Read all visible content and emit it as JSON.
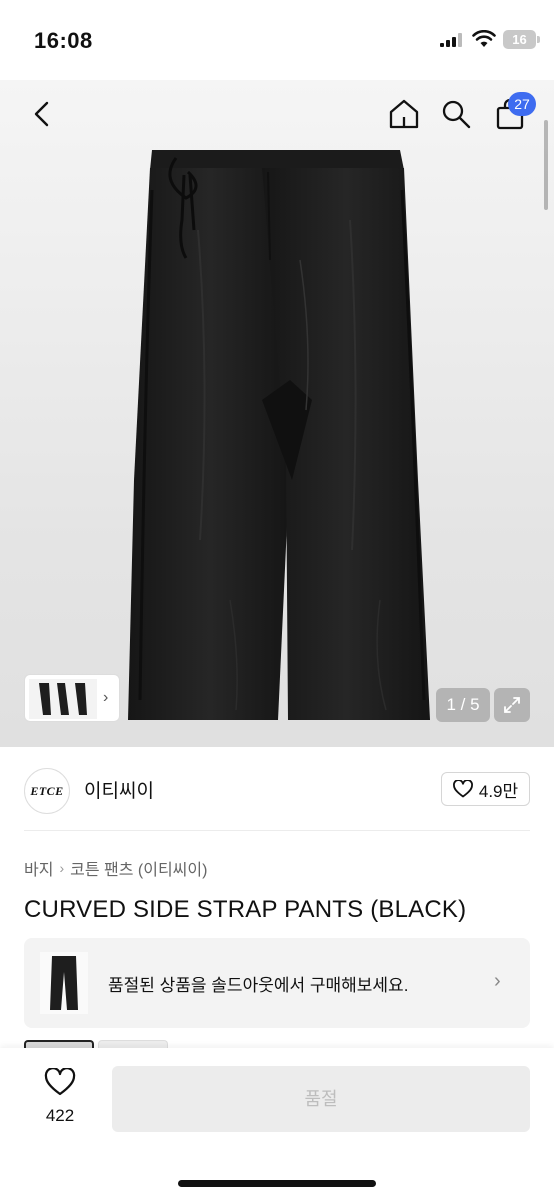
{
  "status_bar": {
    "time": "16:08",
    "battery": "16"
  },
  "nav": {
    "cart_count": "27"
  },
  "gallery": {
    "page_indicator": "1 / 5"
  },
  "brand": {
    "logo_text": "ETCE",
    "name": "이티씨이",
    "likes": "4.9만"
  },
  "breadcrumb": [
    "바지",
    "코튼 팬츠 (이티씨이)"
  ],
  "product": {
    "title": "CURVED SIDE STRAP PANTS (BLACK)"
  },
  "soldout_banner": {
    "text": "품절된 상품을 솔드아웃에서 구매해보세요."
  },
  "bottom_bar": {
    "like_count": "422",
    "buy_label": "품절"
  },
  "colors": {
    "accent": "#3e6cf0",
    "product": "#1e1e1e"
  }
}
